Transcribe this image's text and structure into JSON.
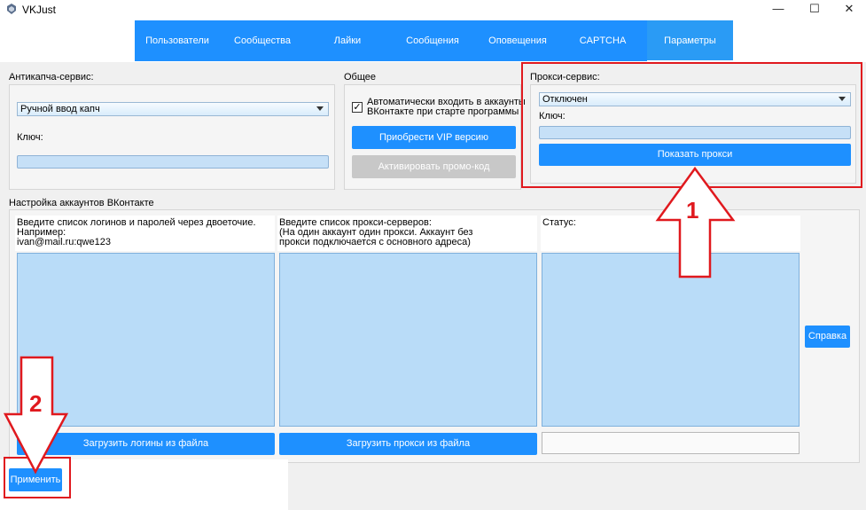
{
  "window": {
    "title": "VKJust",
    "minimize": "—",
    "maximize": "☐",
    "close": "✕"
  },
  "nav": {
    "tabs": [
      {
        "label": "Пользователи"
      },
      {
        "label": "Сообщества"
      },
      {
        "label": "Лайки"
      },
      {
        "label": "Сообщения"
      },
      {
        "label": "Оповещения"
      },
      {
        "label": "CAPTCHA"
      },
      {
        "label": "Параметры",
        "active": true
      }
    ]
  },
  "anticaptcha": {
    "title": "Антикапча-сервис:",
    "selected": "Ручной ввод капч",
    "key_label": "Ключ:",
    "key_value": ""
  },
  "general": {
    "title": "Общее",
    "auto_login_label": "Автоматически входить в аккаунты\nВКонтакте при старте программы",
    "auto_login_checked": true,
    "checkmark": "✓",
    "buy_vip_label": "Приобрести VIP версию",
    "promo_label": "Активировать промо-код"
  },
  "proxy": {
    "title": "Прокси-сервис:",
    "selected": "Отключен",
    "key_label": "Ключ:",
    "key_value": "",
    "show_proxy_label": "Показать прокси"
  },
  "accounts": {
    "title": "Настройка аккаунтов ВКонтакте",
    "logins_desc": "Введите список логинов и паролей через двоеточие.\nНапример:\nivan@mail.ru:qwe123",
    "proxies_desc": "Введите список прокси-серверов:\n(На один аккаунт один прокси. Аккаунт без\nпрокси подключается с основного адреса)",
    "status_desc": "Статус:",
    "load_logins_label": "Загрузить логины из файла",
    "load_proxies_label": "Загрузить прокси из файла",
    "help_label": "Справка",
    "apply_label": "Применить"
  },
  "annotations": {
    "marker_1": "1",
    "marker_2": "2",
    "color": "#e0191e"
  }
}
